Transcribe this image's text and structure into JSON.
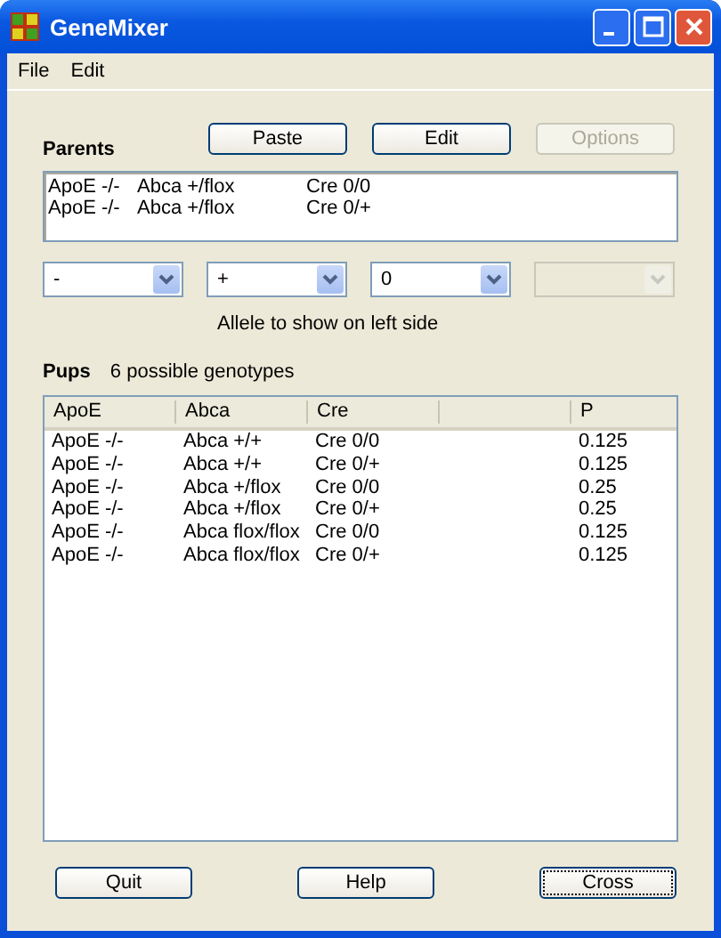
{
  "window": {
    "title": "GeneMixer"
  },
  "menu": [
    "File",
    "Edit"
  ],
  "parents": {
    "label": "Parents",
    "buttons": [
      {
        "label": "Paste",
        "disabled": false
      },
      {
        "label": "Edit",
        "disabled": false
      },
      {
        "label": "Options",
        "disabled": true
      }
    ],
    "rows": [
      [
        "ApoE -/-",
        "Abca +/flox",
        "Cre 0/0"
      ],
      [
        "ApoE -/-",
        "Abca +/flox",
        "Cre 0/+"
      ]
    ]
  },
  "allele_dropdowns": [
    {
      "value": "-",
      "disabled": false
    },
    {
      "value": "+",
      "disabled": false
    },
    {
      "value": "0",
      "disabled": false
    },
    {
      "disabled": true
    }
  ],
  "allele_caption": "Allele to show on left side",
  "pups": {
    "label": "Pups",
    "count": "6 possible genotypes",
    "columns": [
      {
        "label": "ApoE"
      },
      {
        "label": "Abca"
      },
      {
        "label": "Cre"
      },
      {},
      {
        "label": "P"
      }
    ],
    "rows": [
      [
        "ApoE -/-",
        "Abca +/+",
        "Cre 0/0",
        "0.125"
      ],
      [
        "ApoE -/-",
        "Abca +/+",
        "Cre 0/+",
        "0.125"
      ],
      [
        "ApoE -/-",
        "Abca +/flox",
        "Cre 0/0",
        "0.25"
      ],
      [
        "ApoE -/-",
        "Abca +/flox",
        "Cre 0/+",
        "0.25"
      ],
      [
        "ApoE -/-",
        "Abca flox/flox",
        "Cre 0/0",
        "0.125"
      ],
      [
        "ApoE -/-",
        "Abca flox/flox",
        "Cre 0/+",
        "0.125"
      ]
    ]
  },
  "buttons": [
    {
      "label": "Quit",
      "focused": false
    },
    {
      "label": "Help",
      "focused": false
    },
    {
      "label": "Cross",
      "focused": true
    }
  ]
}
